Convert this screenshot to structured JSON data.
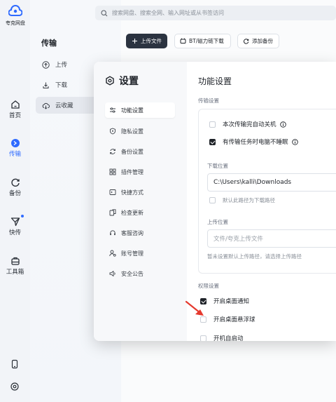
{
  "app": {
    "logo_text": "夸克网盘"
  },
  "rail": {
    "items": [
      {
        "label": "首页"
      },
      {
        "label": "传输"
      },
      {
        "label": "备份"
      },
      {
        "label": "快传"
      },
      {
        "label": "工具箱"
      }
    ]
  },
  "sidebar": {
    "title": "传输",
    "items": [
      {
        "label": "上传"
      },
      {
        "label": "下载"
      },
      {
        "label": "云收藏"
      }
    ]
  },
  "search": {
    "placeholder": "搜索网盘、搜索全网、输入网址或从书签访问"
  },
  "toolbar": {
    "upload_label": "上传文件",
    "bt_label": "BT/磁力链下载",
    "backup_label": "添加备份"
  },
  "settings": {
    "title": "设置",
    "nav": [
      {
        "label": "功能设置"
      },
      {
        "label": "隐私设置"
      },
      {
        "label": "备份设置"
      },
      {
        "label": "插件管理"
      },
      {
        "label": "快捷方式"
      },
      {
        "label": "检查更新"
      },
      {
        "label": "客服咨询"
      },
      {
        "label": "账号管理"
      },
      {
        "label": "安全公告"
      }
    ],
    "panel_title": "功能设置",
    "transfer": {
      "section_label": "传输设置",
      "auto_shutdown": {
        "label": "本次传输完自动关机",
        "checked": false
      },
      "no_sleep": {
        "label": "有传输任务时电脑不睡眠",
        "checked": true
      },
      "download_label": "下载位置",
      "download_path": "C:\\Users\\kalli\\Downloads",
      "default_download": {
        "label": "默认此路径为下载路径",
        "checked": false
      },
      "upload_label": "上传位置",
      "upload_placeholder": "文件/夸克上传文件",
      "upload_hint": "暂未设置默认上传路径，请选择上传路径"
    },
    "permissions": {
      "section_label": "权限设置",
      "desktop_notify": {
        "label": "开启桌面通知",
        "checked": true
      },
      "floating_ball": {
        "label": "开启桌面悬浮球",
        "checked": false
      },
      "autostart": {
        "label": "开机自启动",
        "checked": false
      }
    }
  },
  "colors": {
    "accent": "#2f6bff",
    "primary_button": "#2b3340",
    "annotation_arrow": "#e5392e"
  }
}
